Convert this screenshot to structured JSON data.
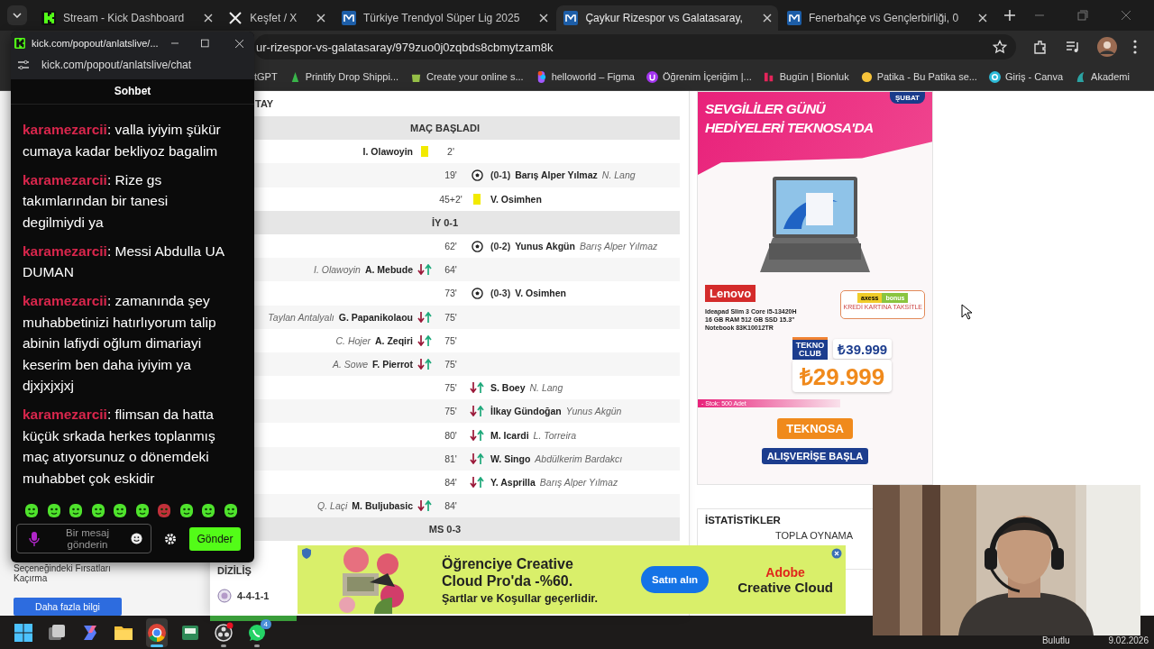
{
  "browser": {
    "tabs": [
      {
        "title": "Stream - Kick Dashboard",
        "selected": false
      },
      {
        "title": "Keşfet / X",
        "selected": false
      },
      {
        "title": "Türkiye Trendyol Süper Lig 2025",
        "selected": false
      },
      {
        "title": "Çaykur Rizespor vs Galatasaray,",
        "selected": true
      },
      {
        "title": "Fenerbahçe vs Gençlerbirliği, 0",
        "selected": false
      }
    ],
    "address": "ur-rizespor-vs-galatasaray/979zuo0j0zqbds8cbmytzam8k",
    "bookmarks": [
      "tGPT",
      "Printify Drop Shippi...",
      "Create your online s...",
      "helloworld – Figma",
      "Öğrenim İçeriğim |...",
      "Bugün | Bionluk",
      "Patika - Bu Patika se...",
      "Giriş - Canva",
      "Akademi"
    ]
  },
  "page": {
    "left": {
      "text": "Seçeneğindeki Fırsatları Kaçırma",
      "button": "Daha fazla bilgi"
    },
    "section_title": "TAY",
    "events": [
      {
        "kind": "header",
        "text": "MAÇ BAŞLADI"
      },
      {
        "kind": "card",
        "minute": "2'",
        "home": {
          "player": "I. Olawoyin"
        }
      },
      {
        "kind": "goal",
        "minute": "19'",
        "away": {
          "score": "(0-1)",
          "player": "Barış Alper Yılmaz",
          "detail": "N. Lang"
        }
      },
      {
        "kind": "card",
        "minute": "45+2'",
        "away": {
          "player": "V. Osimhen"
        }
      },
      {
        "kind": "header",
        "text": "İY 0-1"
      },
      {
        "kind": "goal",
        "minute": "62'",
        "away": {
          "score": "(0-2)",
          "player": "Yunus Akgün",
          "detail": "Barış Alper Yılmaz"
        }
      },
      {
        "kind": "sub",
        "minute": "64'",
        "home": {
          "player": "A. Mebude",
          "detail": "I. Olawoyin"
        }
      },
      {
        "kind": "goal",
        "minute": "73'",
        "away": {
          "score": "(0-3)",
          "player": "V. Osimhen"
        }
      },
      {
        "kind": "sub",
        "minute": "75'",
        "home": {
          "player": "G. Papanikolaou",
          "detail": "Taylan Antalyalı"
        }
      },
      {
        "kind": "sub",
        "minute": "75'",
        "home": {
          "player": "A. Zeqiri",
          "detail": "C. Hojer"
        }
      },
      {
        "kind": "sub",
        "minute": "75'",
        "home": {
          "player": "F. Pierrot",
          "detail": "A. Sowe"
        }
      },
      {
        "kind": "sub",
        "minute": "75'",
        "away": {
          "player": "S. Boey",
          "detail": "N. Lang"
        }
      },
      {
        "kind": "sub",
        "minute": "75'",
        "away": {
          "player": "İlkay Gündoğan",
          "detail": "Yunus Akgün"
        }
      },
      {
        "kind": "sub",
        "minute": "80'",
        "away": {
          "player": "M. Icardi",
          "detail": "L. Torreira"
        }
      },
      {
        "kind": "sub",
        "minute": "81'",
        "away": {
          "player": "W. Singo",
          "detail": "Abdülkerim Bardakcı"
        }
      },
      {
        "kind": "sub",
        "minute": "84'",
        "away": {
          "player": "Y. Asprilla",
          "detail": "Barış Alper Yılmaz"
        }
      },
      {
        "kind": "sub",
        "minute": "84'",
        "home": {
          "player": "M. Buljubasic",
          "detail": "Q. Laçi"
        }
      },
      {
        "kind": "header",
        "text": "MS 0-3"
      }
    ],
    "lineup": {
      "title": "DİZİLİŞ",
      "formation": "4-4-1-1"
    },
    "ad": {
      "month": "ŞUBAT",
      "headline": [
        "SEVGİLİLER GÜNÜ",
        "HEDİYELERİ TEKNOSA'DA"
      ],
      "brand": "Lenovo",
      "specs": [
        "Ideapad Slim 3 Core i5-13420H",
        "16 GB RAM 512 GB SSD 15.3\"",
        "Notebook 83K10012TR"
      ],
      "card": [
        "axess",
        "bonus",
        "KREDİ KARTINA TAKSİTLE"
      ],
      "club": [
        "TEKNO",
        "CLUB"
      ],
      "old_price": "₺39.999",
      "price": "₺29.999",
      "stock": "- Stok: 500 Adet",
      "store": "TEKNOSA",
      "cta": "ALIŞVERİŞE BAŞLA"
    },
    "stats": {
      "title": "İSTATİSTİKLER",
      "first": "TOPLA OYNAMA"
    },
    "banner": {
      "headline": [
        "Öğrenciye Creative",
        "Cloud Pro'da -%60."
      ],
      "terms": "Şartlar ve Koşullar geçerlidir.",
      "button": "Satın alın",
      "brand": [
        "Adobe",
        "Creative Cloud"
      ]
    }
  },
  "chat": {
    "window_title": "kick.com/popout/anlatslive/...",
    "url": "kick.com/popout/anlatslive/chat",
    "header": "Sohbet",
    "messages": [
      {
        "user": "karamezarcii",
        "text": ": valla iyiyim şükür cumaya kadar bekliyoz bagalim"
      },
      {
        "user": "karamezarcii",
        "text": ": Rize gs takımlarından bir tanesi degilmiydi ya"
      },
      {
        "user": "karamezarcii",
        "text": ": Messi Abdulla UA DUMAN"
      },
      {
        "user": "karamezarcii",
        "text": ": zamanında şey muhabbetinizi hatırlıyorum talip abinin lafiydi oğlum dimariayi keserim ben daha iyiyim ya djxjxjxjxj"
      },
      {
        "user": "karamezarcii",
        "text": ": flimsan da hatta küçük srkada herkes toplanmış maç atıyorsunuz o dönemdeki muhabbet çok eskidir"
      }
    ],
    "placeholder": "Bir mesaj gönderin",
    "send": "Gönder"
  },
  "taskbar": {
    "apps": [
      {
        "kind": "start",
        "running": false,
        "selected": false
      },
      {
        "kind": "taskview",
        "running": false,
        "selected": false
      },
      {
        "kind": "copilot",
        "running": false,
        "selected": false
      },
      {
        "kind": "folder",
        "running": false,
        "selected": false
      },
      {
        "kind": "chrome",
        "running": true,
        "selected": true
      },
      {
        "kind": "app",
        "running": false,
        "selected": false
      },
      {
        "kind": "obs",
        "running": true,
        "selected": false
      },
      {
        "kind": "whatsapp",
        "running": true,
        "selected": false,
        "badge": "4"
      }
    ],
    "weather": "Bulutlu",
    "date": "9.02.2026"
  }
}
